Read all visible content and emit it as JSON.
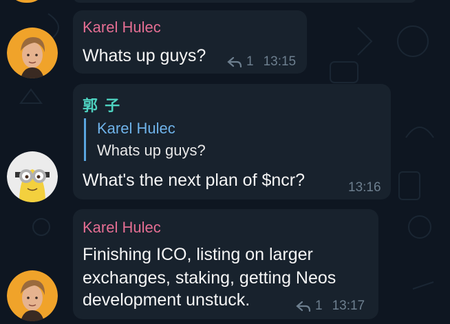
{
  "messages": [
    {
      "sender": "Karel Hulec",
      "text": "Whats up guys?",
      "reply_count": "1",
      "time": "13:15",
      "avatar": "user-avatar-orange"
    },
    {
      "sender": "郭 子",
      "quote": {
        "sender": "Karel Hulec",
        "text": "Whats up guys?"
      },
      "text": "What's the next plan of $ncr?",
      "time": "13:16",
      "avatar": "minion-avatar"
    },
    {
      "sender": "Karel Hulec",
      "text_lines": [
        "Finishing ICO, listing on larger",
        "exchanges, staking, getting Neos",
        "development unstuck."
      ],
      "reply_count": "1",
      "time": "13:17",
      "avatar": "user-avatar-orange"
    }
  ],
  "colors": {
    "background": "#0e1621",
    "bubble": "#18222d",
    "sender_pink": "#e56e93",
    "sender_teal": "#4ed2c0",
    "quote_bar": "#5aa6e0",
    "meta": "#6d7f8f"
  }
}
